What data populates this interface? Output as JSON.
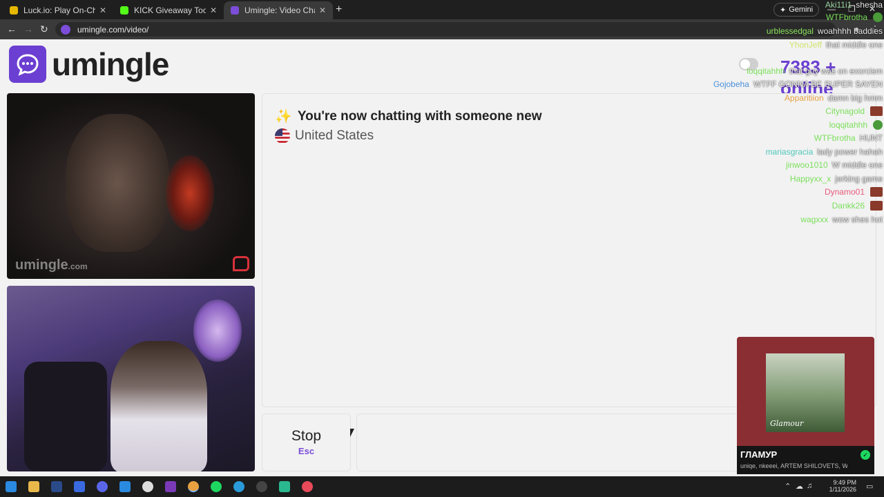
{
  "browser": {
    "tabs": [
      {
        "title": "Luck.io: Play On-Chain Prov",
        "favicon_color": "#e6b800"
      },
      {
        "title": "KICK Giveaway Tool",
        "favicon_color": "#53fc18"
      },
      {
        "title": "Umingle: Video Chat with S",
        "favicon_color": "#7b4dd8"
      }
    ],
    "new_tab": "+",
    "gemini_label": "Gemini",
    "url": "umingle.com/video/"
  },
  "site": {
    "logo_text": "umingle",
    "online_count": "7383 + online",
    "watermark": "umingle",
    "watermark_suffix": ".com"
  },
  "chat": {
    "header": "You're now chatting with someone new",
    "country": "United States"
  },
  "controls": {
    "stop_label": "Stop",
    "stop_key": "Esc"
  },
  "stream_chat": [
    {
      "name": "Aki11i1",
      "msg": "shesha",
      "color": "#9ad3a1"
    },
    {
      "name": "WTFbrotha",
      "msg": "",
      "color": "#7adf5a",
      "emote": "g"
    },
    {
      "name": "urblessedgal",
      "msg": "woahhhh baddies",
      "color": "#8be35c"
    },
    {
      "name": "YhonJeff",
      "msg": "that middle one",
      "color": "#d0e46a"
    },
    {
      "name": "loqqitahhh",
      "msg": "that guy was on exorcism",
      "color": "#7adf5a"
    },
    {
      "name": "Gojobeha",
      "msg": "WTFF GONNA BE SUPER SAYEN",
      "color": "#4a8fd8"
    },
    {
      "name": "Apparitiion",
      "msg": "damn big hmm",
      "color": "#e6a040"
    },
    {
      "name": "Citynagold",
      "msg": "",
      "color": "#7adf5a",
      "emote": "r"
    },
    {
      "name": "loqqitahhh",
      "msg": "",
      "color": "#7adf5a",
      "emote": "g"
    },
    {
      "name": "WTFbrotha",
      "msg": "HUNT",
      "color": "#7adf5a"
    },
    {
      "name": "mariasgracia",
      "msg": "lady power hahah",
      "color": "#4fc7b8"
    },
    {
      "name": "jinwoo1010",
      "msg": "W middle one",
      "color": "#7adf5a"
    },
    {
      "name": "Happyxx_x",
      "msg": "jerking game",
      "color": "#7adf5a"
    },
    {
      "name": "Dynamo01",
      "msg": "",
      "color": "#e85a7a",
      "emote": "r"
    },
    {
      "name": "Dankk26",
      "msg": "",
      "color": "#7adf5a",
      "emote": "r"
    },
    {
      "name": "wagxxx",
      "msg": "wow shes hot",
      "color": "#7adf5a"
    }
  ],
  "spotify": {
    "track": "ГЛАМУР",
    "artists": "uniqe, nkeeei, ARTEM SHILOVETS, Wipo",
    "cover_caption": "Glamour"
  },
  "taskbar": {
    "time": "9:49 PM",
    "date": "1/11/2026"
  }
}
